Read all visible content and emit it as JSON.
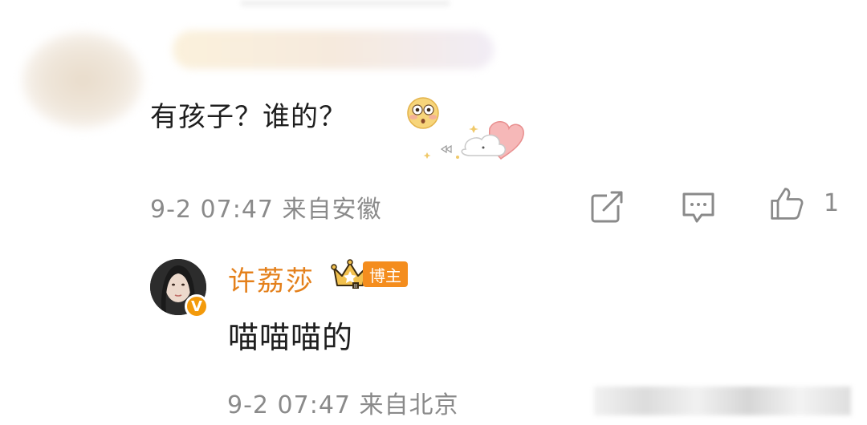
{
  "comment": {
    "text": "有孩子？谁的？",
    "emoji_icon": "flushed-face-icon",
    "sticker_icon": "cloud-heart-sticker-icon",
    "meta": "9-2 07:47  来自安徽",
    "like_count": "1"
  },
  "reply": {
    "author_name": "许荔莎",
    "badge_label": "博主",
    "verified_mark": "V",
    "text": "喵喵喵的",
    "meta": "9-2 07:47  来自北京"
  },
  "colors": {
    "author_name": "#e4801b",
    "badge_bg": "#f48d1e",
    "meta_text": "#8a8a8a"
  }
}
